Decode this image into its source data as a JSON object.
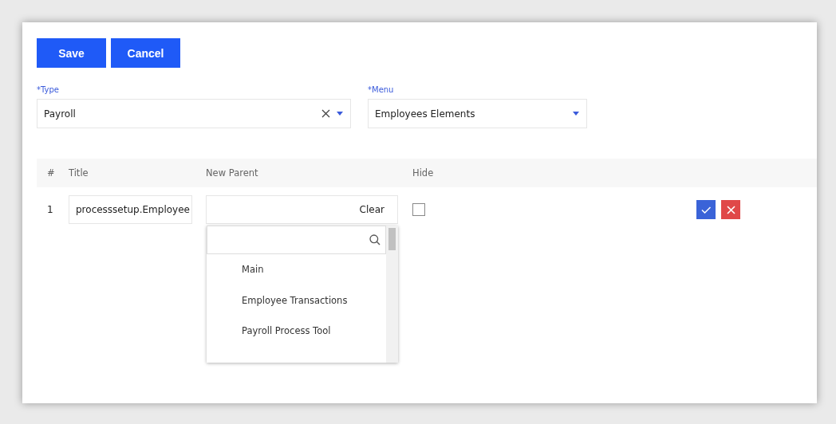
{
  "buttons": [
    {
      "label": "Save",
      "kind": "primary"
    },
    {
      "label": "Cancel",
      "kind": "primary"
    }
  ],
  "fields": [
    {
      "label": "*Type",
      "value": "Payroll",
      "clearable": true
    },
    {
      "label": "*Menu",
      "value": "Employees Elements",
      "clearable": false
    }
  ],
  "table": {
    "columns": [
      "#",
      "Title",
      "New Parent",
      "Hide"
    ],
    "rows": [
      {
        "number": "1",
        "title": "processsetup.Employee",
        "clear_label": "Clear",
        "hide": false
      }
    ]
  },
  "dropdown": {
    "items": [
      "Main",
      "Employee Transactions",
      "Payroll Process Tool"
    ]
  }
}
